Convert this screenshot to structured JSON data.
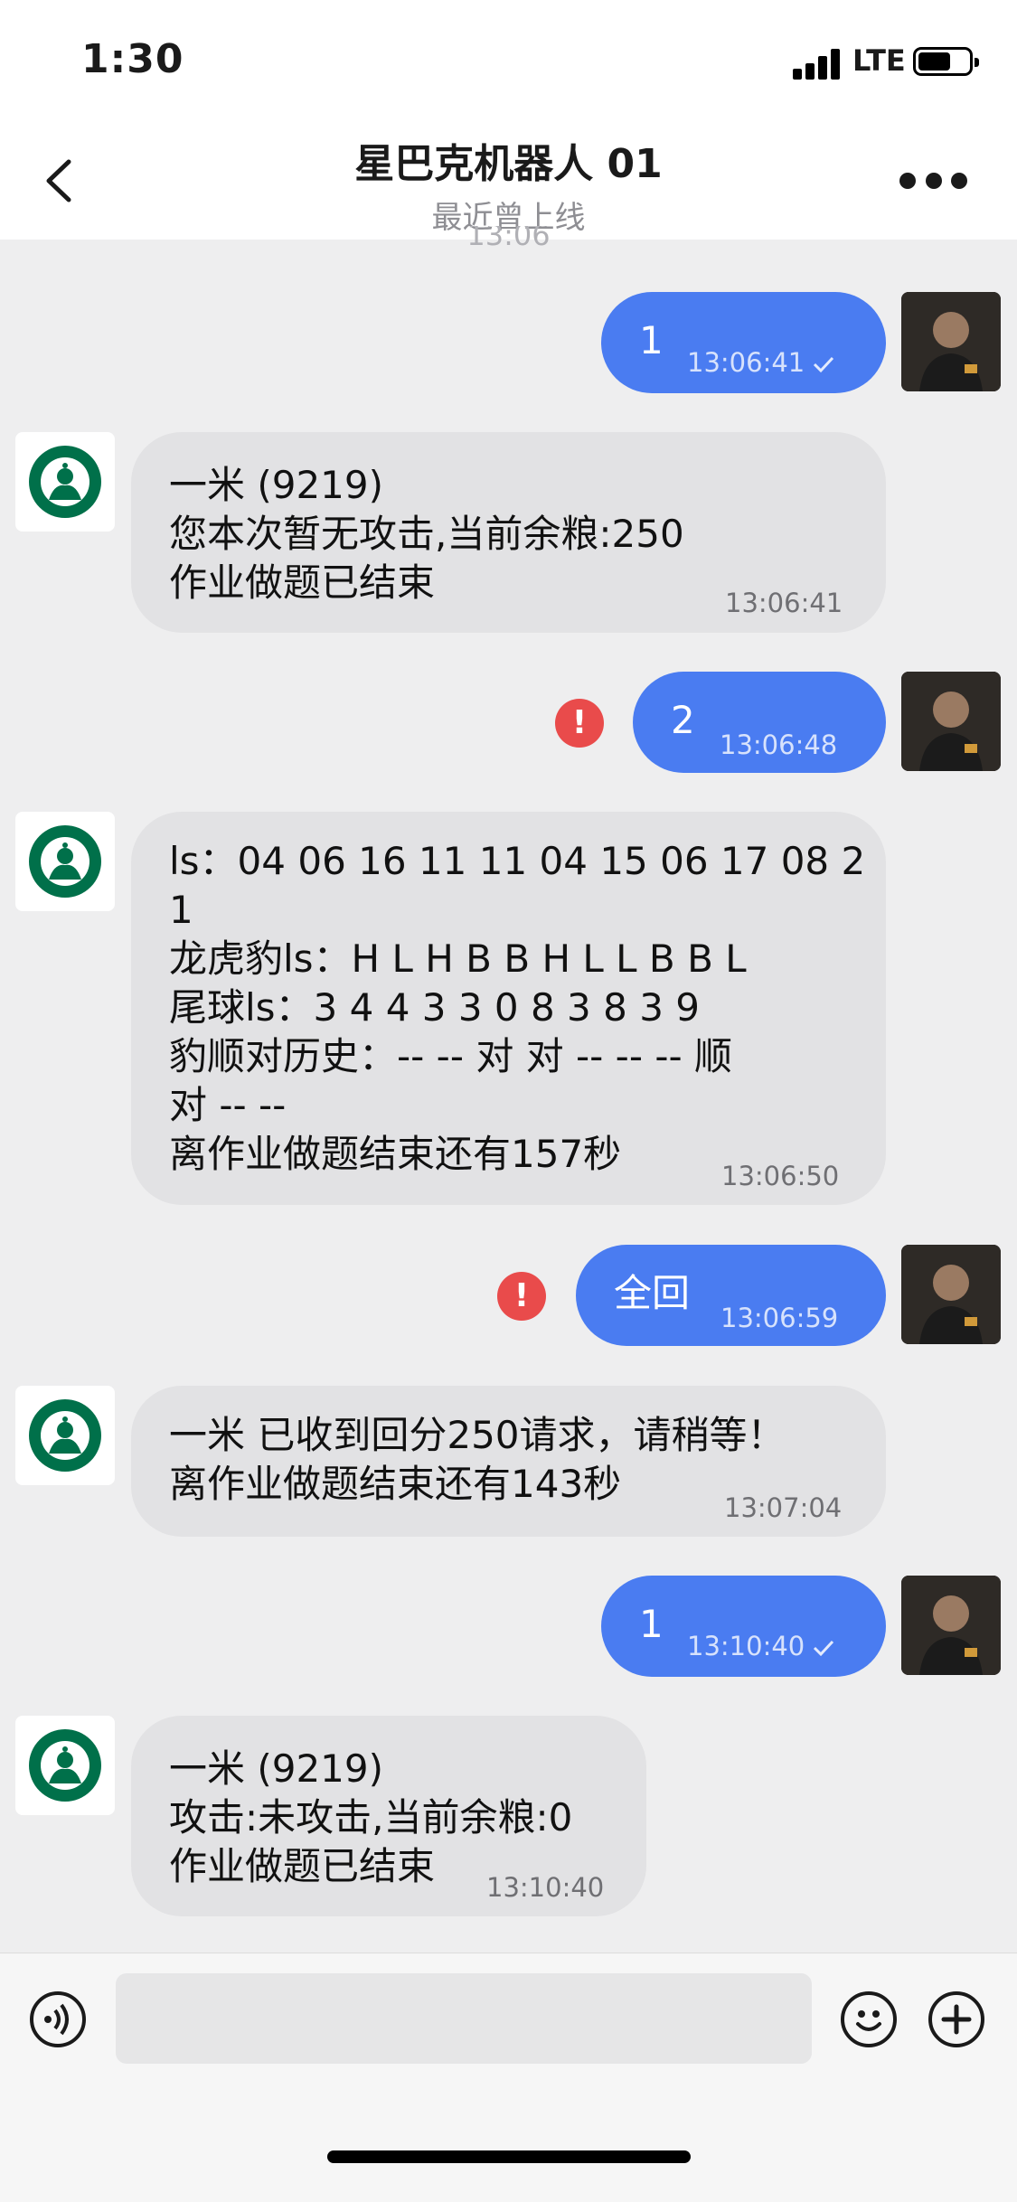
{
  "status_bar": {
    "time": "1:30",
    "network": "LTE",
    "battery_level": 0.65
  },
  "header": {
    "title": "星巴克机器人 01",
    "subtitle": "最近曾上线",
    "back_icon": "chevron-left-icon",
    "more_icon": "more-dots-icon"
  },
  "ghost_timestamp": "13:06",
  "messages": [
    {
      "direction": "out",
      "text": "1",
      "time": "13:06:41",
      "status": "sent"
    },
    {
      "direction": "in",
      "text": "一米 (9219)\n您本次暂无攻击,当前余粮:250\n作业做题已结束",
      "time": "13:06:41"
    },
    {
      "direction": "out",
      "text": "2",
      "time": "13:06:48",
      "status": "failed"
    },
    {
      "direction": "in",
      "text": "ls：04 06 16 11 11 04 15 06 17 08 2\n1\n龙虎豹ls：H L H B B H L L B B L\n尾球ls：3 4 4 3 3 0 8 3 8 3 9\n豹顺对历史：-- -- 对 对 -- -- -- 顺\n对 -- --\n离作业做题结束还有157秒",
      "time": "13:06:50"
    },
    {
      "direction": "out",
      "text": "全回",
      "time": "13:06:59",
      "status": "failed"
    },
    {
      "direction": "in",
      "text": "一米 已收到回分250请求，请稍等！\n离作业做题结束还有143秒",
      "time": "13:07:04"
    },
    {
      "direction": "out",
      "text": "1",
      "time": "13:10:40",
      "status": "sent"
    },
    {
      "direction": "in",
      "text": "一米 (9219)\n攻击:未攻击,当前余粮:0\n作业做题已结束",
      "time": "13:10:40"
    }
  ],
  "input_bar": {
    "voice_icon": "voice-icon",
    "emoji_icon": "emoji-icon",
    "add_icon": "plus-icon",
    "input_value": ""
  },
  "colors": {
    "outgoing_bubble": "#4a7cf1",
    "incoming_bubble": "#e2e2e4",
    "error": "#e94b4b",
    "brand_green": "#00704a"
  }
}
